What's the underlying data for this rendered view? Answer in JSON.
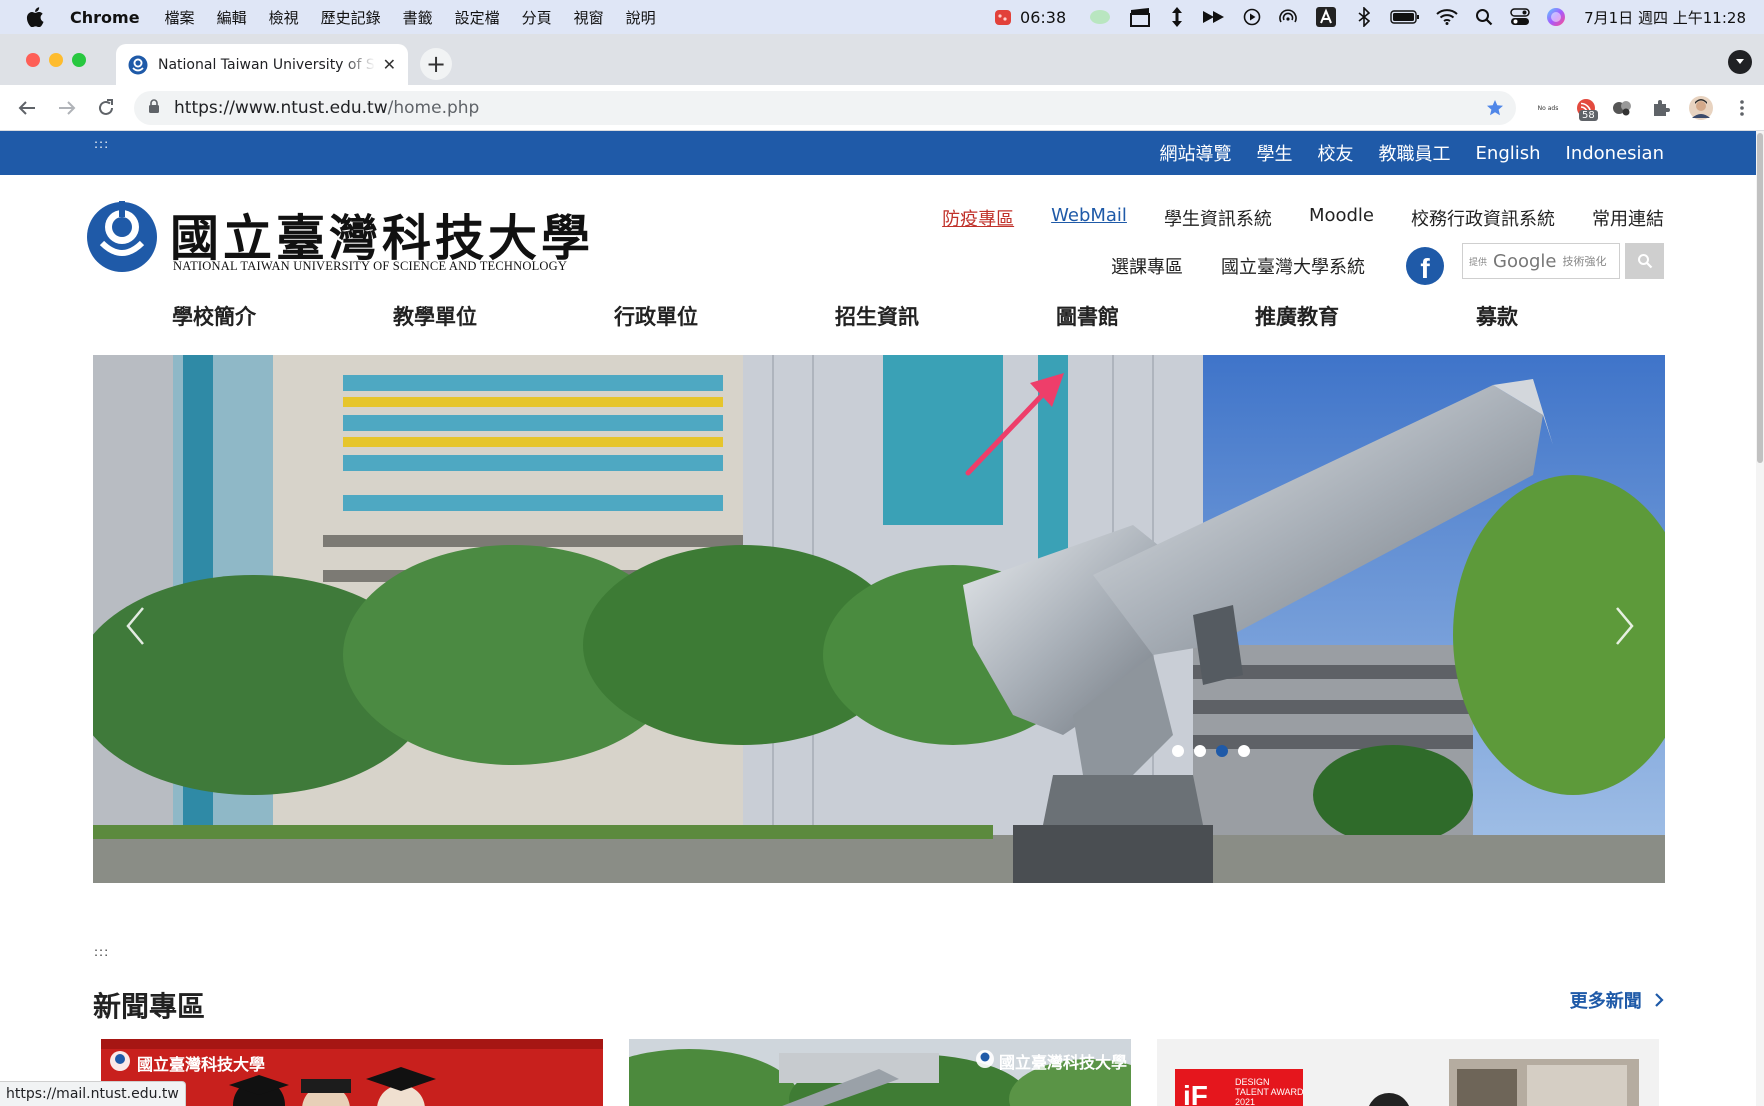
{
  "menubar": {
    "app_name": "Chrome",
    "menus": [
      "檔案",
      "編輯",
      "檢視",
      "歷史記錄",
      "書籤",
      "設定檔",
      "分頁",
      "視窗",
      "說明"
    ],
    "timer": "06:38",
    "datetime": "7月1日 週四 上午11:28"
  },
  "browser": {
    "tab_title": "National Taiwan University of Science and Technology",
    "new_tab_label": "+",
    "url_host": "https://www.ntust.edu.tw",
    "url_path": "/home.php",
    "ext_badge": "58",
    "ext_noads": "No ads",
    "status_url": "https://mail.ntust.edu.tw"
  },
  "page": {
    "accesskey_top": ":::",
    "top_links": [
      "網站導覽",
      "學生",
      "校友",
      "教職員工",
      "English",
      "Indonesian"
    ],
    "logo_cn": "國立臺灣科技大學",
    "logo_en": "NATIONAL TAIWAN UNIVERSITY OF SCIENCE AND TECHNOLOGY",
    "quick_links": [
      "防疫專區",
      "WebMail",
      "學生資訊系統",
      "Moodle",
      "校務行政資訊系統",
      "常用連結"
    ],
    "quick_links_2": [
      "選課專區",
      "國立臺灣大學系統"
    ],
    "facebook_label": "f",
    "search_prefix": "提供",
    "search_google": "Google",
    "search_suffix": "技術強化",
    "main_nav": [
      "學校簡介",
      "教學單位",
      "行政單位",
      "招生資訊",
      "圖書館",
      "推廣教育",
      "募款"
    ],
    "slides_count": 4,
    "slide_active_index": 3,
    "accesskey_center": ":::",
    "news_title": "新聞專區",
    "more_news": "更多新聞",
    "card_logo_text": "國立臺灣科技大學",
    "card3_award": "DESIGN TALENT AWARD 2021"
  },
  "colors": {
    "primary": "#1f5aa8",
    "alert_red": "#c0312a",
    "annotation_arrow": "#ee3e6a"
  }
}
